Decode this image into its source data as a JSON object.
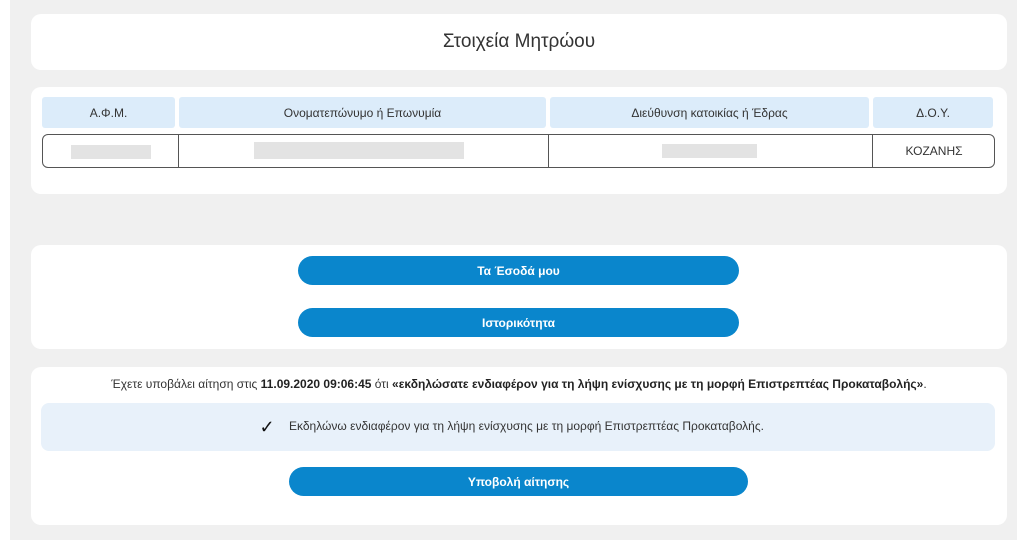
{
  "header": {
    "title": "Στοιχεία Μητρώου"
  },
  "registry_table": {
    "columns": [
      "Α.Φ.Μ.",
      "Ονοματεπώνυμο ή Επωνυμία",
      "Διεύθυνση κατοικίας ή Έδρας",
      "Δ.Ο.Υ."
    ],
    "row": {
      "afm": "",
      "name": "",
      "address": "",
      "doy": "ΚΟΖΑΝΗΣ"
    }
  },
  "actions": {
    "income_button": "Τα Έσοδά μου",
    "history_button": "Ιστορικότητα"
  },
  "application": {
    "notice_prefix": "Έχετε υποβάλει αίτηση στις",
    "notice_datetime": "11.09.2020 09:06:45",
    "notice_middle": "ότι",
    "notice_declaration": "«εκδηλώσατε ενδιαφέρον για τη λήψη ενίσχυσης με τη μορφή Επιστρεπτέας Προκαταβολής»",
    "notice_suffix": ".",
    "declaration_checked": true,
    "checkbox_mark": "✓",
    "declaration_label": "Εκδηλώνω ενδιαφέρον για τη λήψη ενίσχυσης με τη μορφή Επιστρεπτέας Προκαταβολής.",
    "submit_button": "Υποβολή αίτησης"
  },
  "colors": {
    "primary_button": "#0a86cc",
    "table_header_bg": "#dcecfa",
    "declaration_bg": "#e8f1fa",
    "page_bg": "#f0f0f0"
  }
}
